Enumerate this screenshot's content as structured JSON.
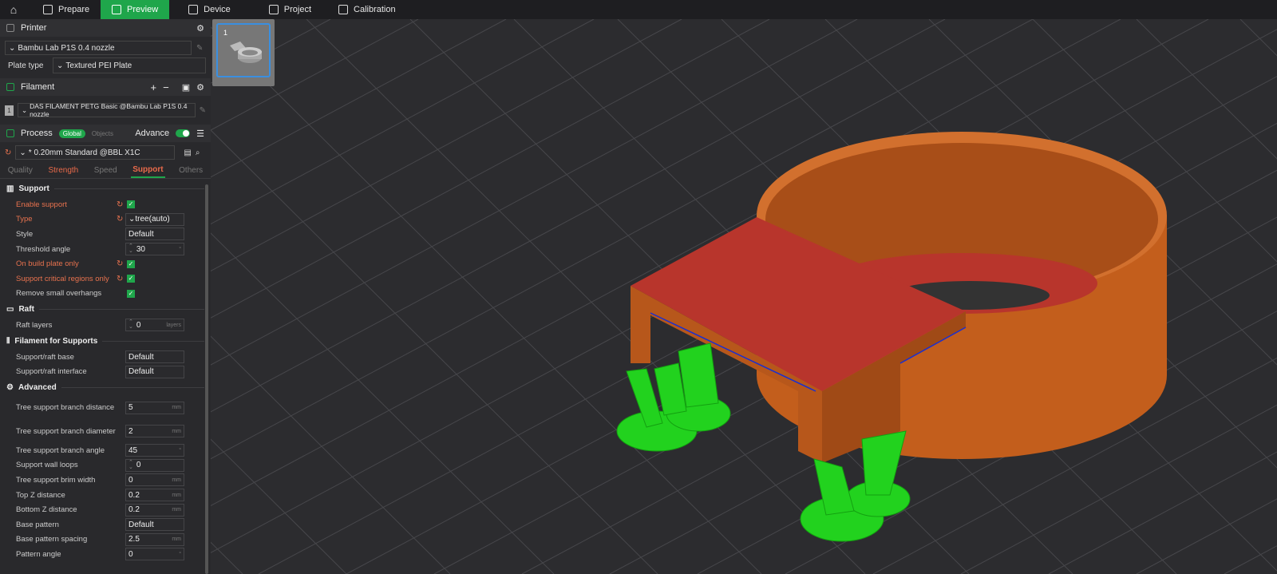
{
  "topbar": {
    "tabs": [
      {
        "label": "Prepare"
      },
      {
        "label": "Preview",
        "active": true
      },
      {
        "label": "Device"
      },
      {
        "label": "Project"
      },
      {
        "label": "Calibration"
      }
    ]
  },
  "printer": {
    "title": "Printer",
    "preset": "Bambu Lab P1S 0.4 nozzle",
    "plate_type_label": "Plate type",
    "plate_type": "Textured PEI Plate"
  },
  "filament": {
    "title": "Filament",
    "add": "+",
    "remove": "−",
    "slot": "1",
    "preset": "DAS FILAMENT PETG Basic @Bambu Lab P1S 0.4 nozzle"
  },
  "process": {
    "title": "Process",
    "global": "Global",
    "objects": "Objects",
    "advance": "Advance",
    "preset": "* 0.20mm Standard @BBL X1C",
    "tabs": [
      "Quality",
      "Strength",
      "Speed",
      "Support",
      "Others"
    ]
  },
  "support": {
    "title": "Support",
    "rows": [
      {
        "name": "Enable support",
        "type": "check",
        "modified": true
      },
      {
        "name": "Type",
        "value": "tree(auto)",
        "modified": true,
        "combo": true
      },
      {
        "name": "Style",
        "value": "Default"
      },
      {
        "name": "Threshold angle",
        "value": "30",
        "unit": "°",
        "spin": true
      },
      {
        "name": "On build plate only",
        "type": "check",
        "modified": true
      },
      {
        "name": "Support critical regions only",
        "type": "check",
        "modified": true
      },
      {
        "name": "Remove small overhangs",
        "type": "check"
      }
    ]
  },
  "raft": {
    "title": "Raft",
    "rows": [
      {
        "name": "Raft layers",
        "value": "0",
        "unit": "layers",
        "spin": true
      }
    ]
  },
  "filament_supports": {
    "title": "Filament for Supports",
    "rows": [
      {
        "name": "Support/raft base",
        "value": "Default"
      },
      {
        "name": "Support/raft interface",
        "value": "Default"
      }
    ]
  },
  "advanced": {
    "title": "Advanced",
    "rows": [
      {
        "name": "Tree support branch distance",
        "value": "5",
        "unit": "mm",
        "tall": true
      },
      {
        "name": "Tree support branch diameter",
        "value": "2",
        "unit": "mm",
        "tall": true
      },
      {
        "name": "Tree support branch angle",
        "value": "45",
        "unit": "°"
      },
      {
        "name": "Support wall loops",
        "value": "0",
        "spin": true
      },
      {
        "name": "Tree support brim width",
        "value": "0",
        "unit": "mm"
      },
      {
        "name": "Top Z distance",
        "value": "0.2",
        "unit": "mm"
      },
      {
        "name": "Bottom Z distance",
        "value": "0.2",
        "unit": "mm"
      },
      {
        "name": "Base pattern",
        "value": "Default"
      },
      {
        "name": "Base pattern spacing",
        "value": "2.5",
        "unit": "mm"
      },
      {
        "name": "Pattern angle",
        "value": "0",
        "unit": "°"
      }
    ]
  },
  "plate_thumbnail": {
    "number": "1"
  },
  "colors": {
    "accent": "#1fa64b",
    "modified": "#e8724e",
    "model": "#c35e1c",
    "top": "#b8352c",
    "support": "#22d21e"
  }
}
